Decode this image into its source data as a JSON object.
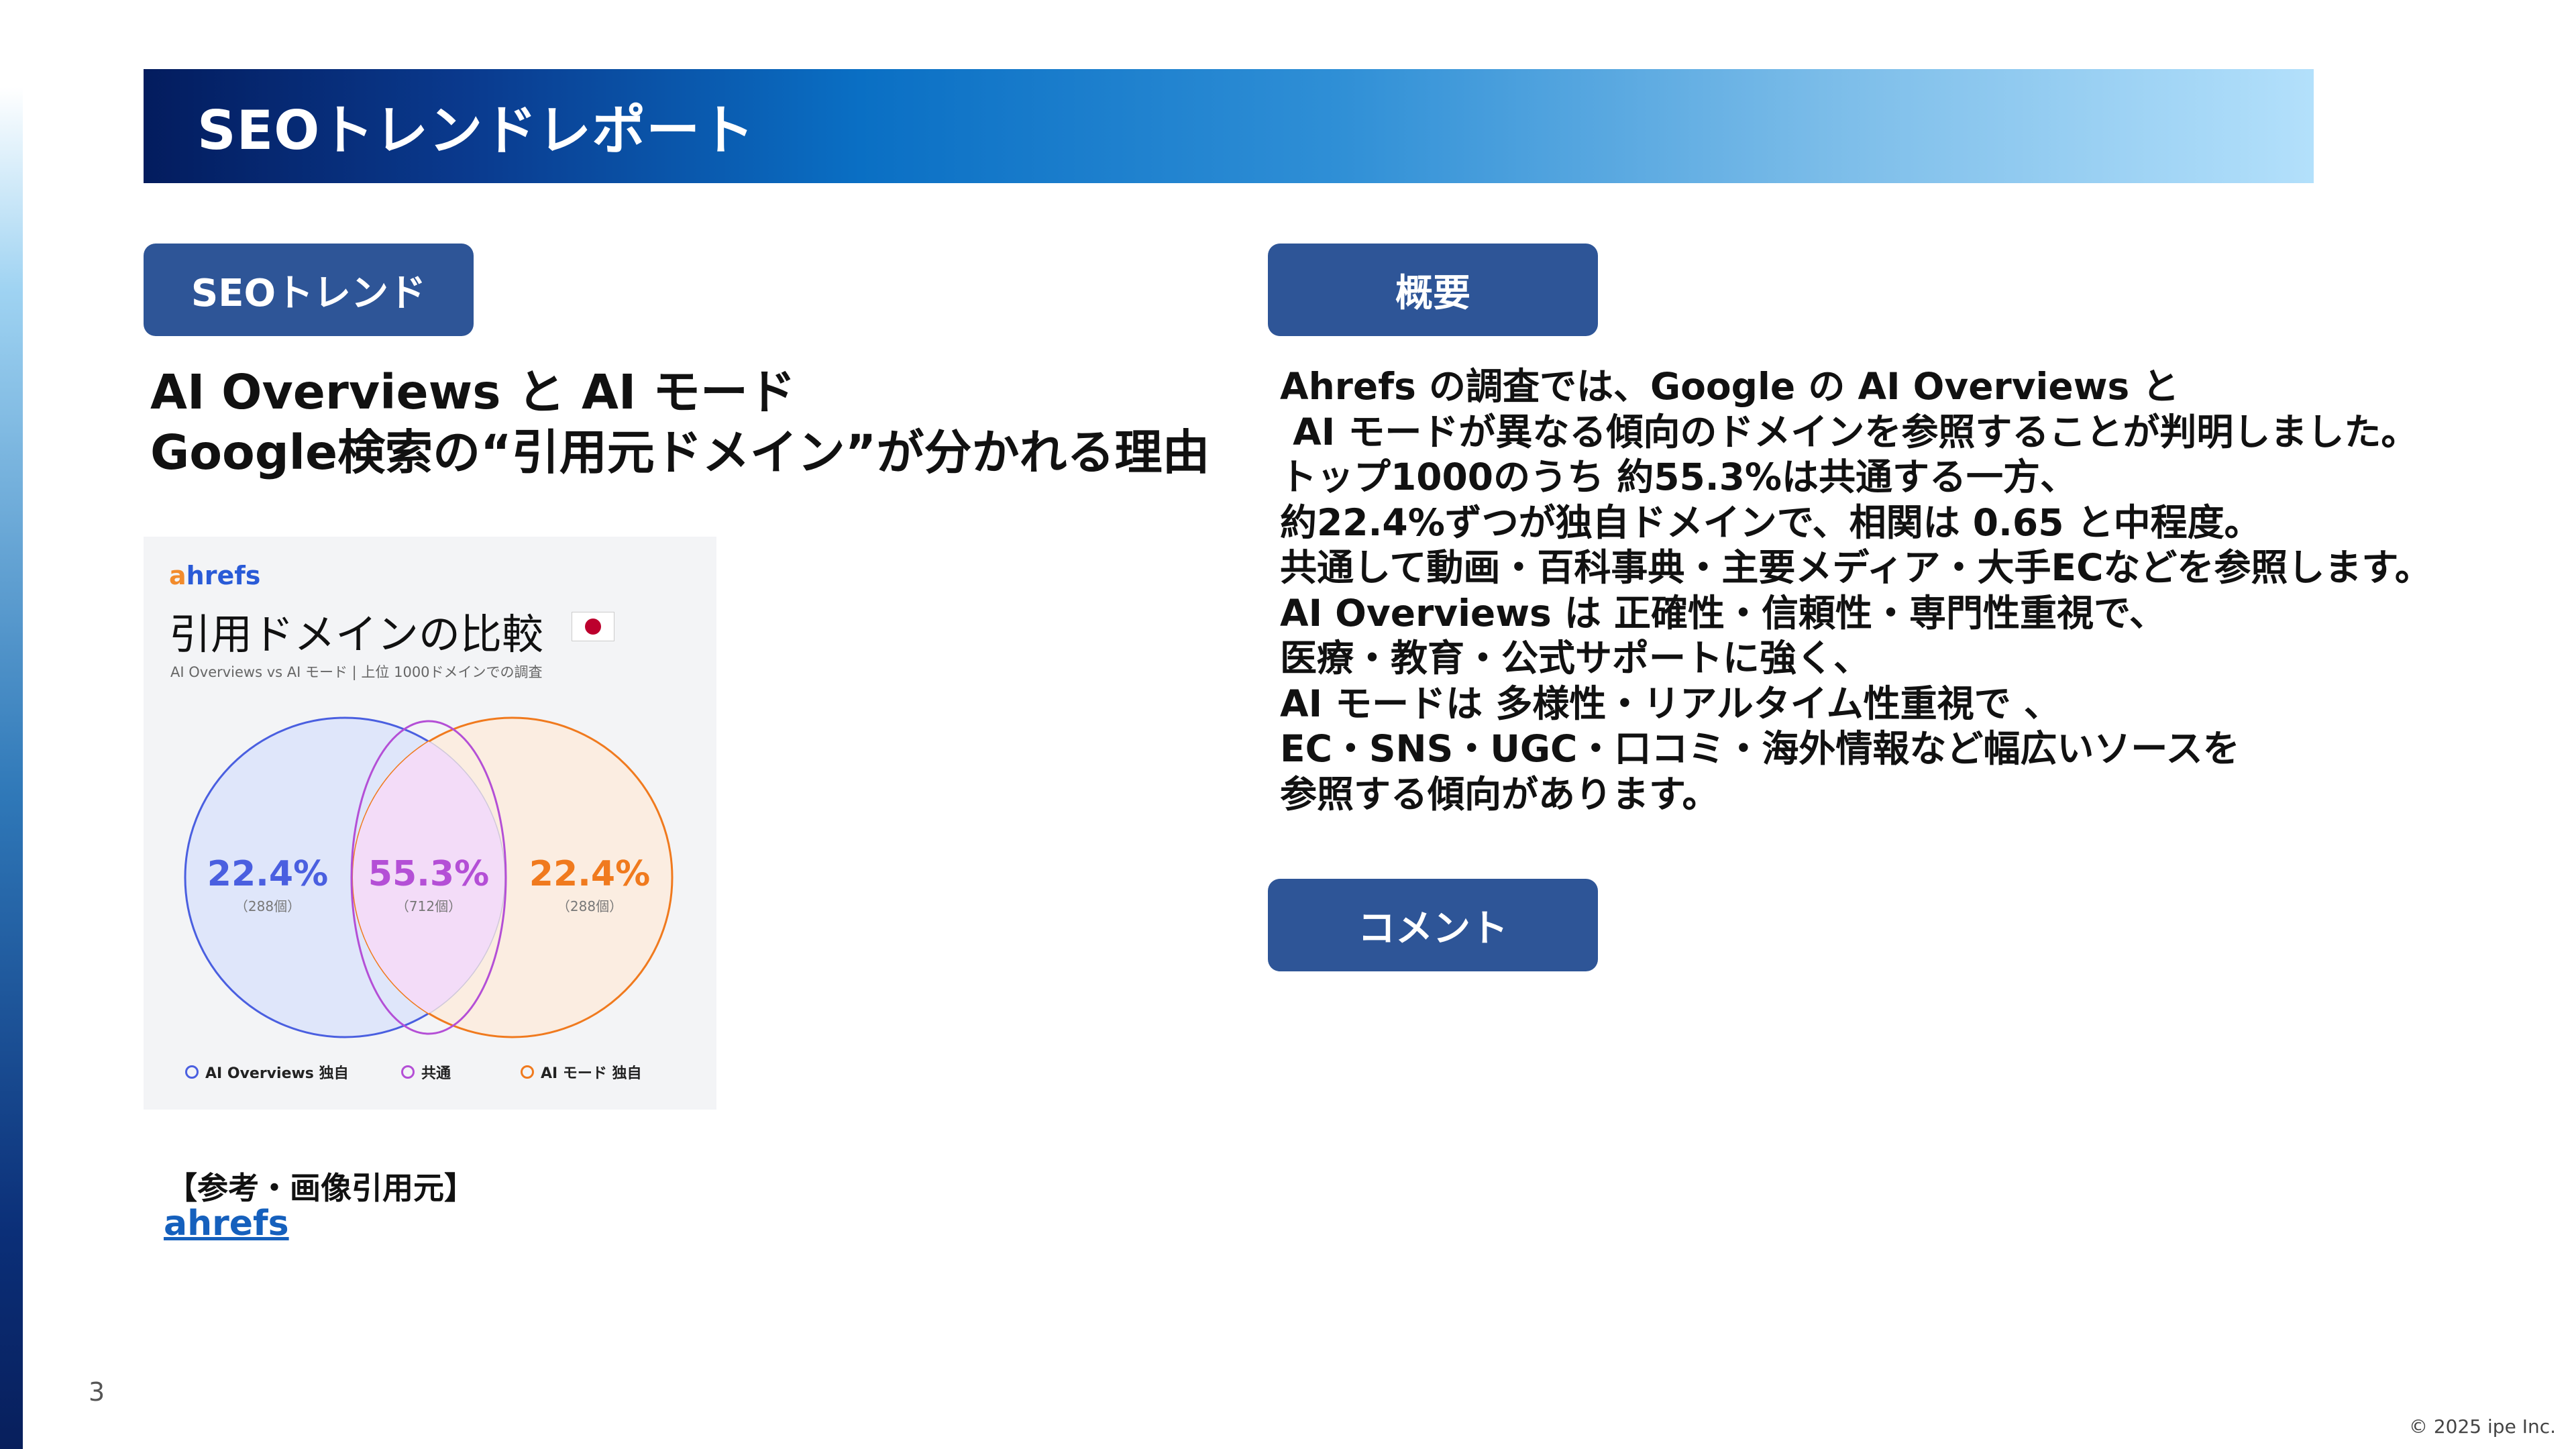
{
  "header": {
    "title": "SEOトレンドレポート"
  },
  "section_labels": {
    "seo_trend": "SEOトレンド",
    "summary": "概要",
    "comment": "コメント"
  },
  "headline": {
    "line1": "AI Overviews と AI モード",
    "line2": "Google検索の“引用元ドメイン”が分かれる理由"
  },
  "summary_lines": [
    "Ahrefs の調査では、Google の AI Overviews と",
    " AI モードが異なる傾向のドメインを参照することが判明しました。",
    "トップ1000のうち 約55.3%は共通する一方、",
    "約22.4%ずつが独自ドメインで、相関は 0.65 と中程度。",
    "共通して動画・百科事典・主要メディア・大手ECなどを参照します。",
    "AI Overviews は 正確性・信頼性・専門性重視で、",
    "医療・教育・公式サポートに強く、",
    "AI モードは 多様性・リアルタイム性重視で 、",
    "EC・SNS・UGC・口コミ・海外情報など幅広いソースを",
    "参照する傾向があります。"
  ],
  "chart_image": {
    "brand": "ahrefs",
    "title": "引用ドメインの比較",
    "subtitle": "AI Overviews vs AI モード | 上位 1000ドメインでの調査",
    "colors": {
      "left": "#4a5fe0",
      "middle": "#b44fd6",
      "right": "#f07a1e"
    }
  },
  "chart_data": {
    "type": "venn",
    "sets": [
      {
        "name": "AI Overviews 独自",
        "value_label": "22.4%",
        "count_label": "（288個）",
        "value": 22.4
      },
      {
        "name": "共通",
        "value_label": "55.3%",
        "count_label": "（712個）",
        "value": 55.3
      },
      {
        "name": "AI モード 独自",
        "value_label": "22.4%",
        "count_label": "（288個）",
        "value": 22.4
      }
    ]
  },
  "reference": {
    "label": "【参考・画像引用元】",
    "link_text": "ahrefs"
  },
  "footer": {
    "page_number": "3",
    "copyright": "© 2025 ipe Inc."
  }
}
